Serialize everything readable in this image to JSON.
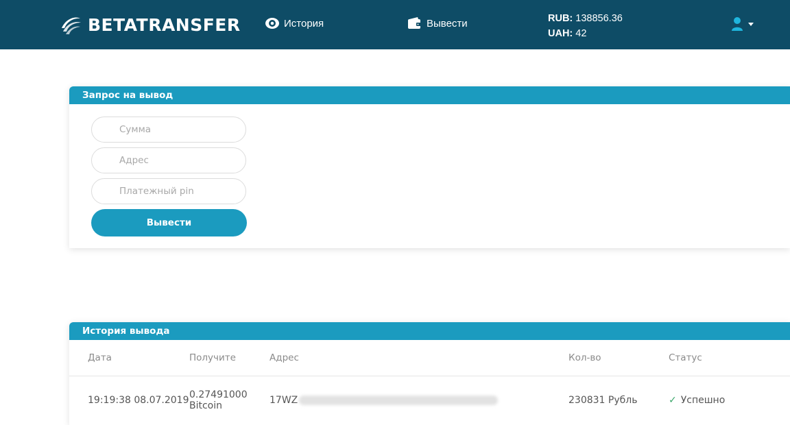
{
  "header": {
    "brand": "BETATRANSFER",
    "nav": [
      {
        "label": "История",
        "icon": "eye-icon"
      },
      {
        "label": "Вывести",
        "icon": "wallet-icon"
      }
    ],
    "balances": [
      {
        "currency": "RUB:",
        "amount": "138856.36"
      },
      {
        "currency": "UAH:",
        "amount": "42"
      }
    ],
    "user_icon": "user-icon"
  },
  "withdraw_form": {
    "title": "Запрос на вывод",
    "amount_placeholder": "Сумма",
    "address_placeholder": "Адрес",
    "pin_placeholder": "Платежный pin",
    "submit_label": "Вывести"
  },
  "history": {
    "title": "История вывода",
    "columns": [
      "Дата",
      "Получите",
      "Адрес",
      "Кол-во",
      "Статус"
    ],
    "rows": [
      {
        "date": "19:19:38 08.07.2019",
        "receive_amount": "0.27491000",
        "receive_currency": "Bitcoin",
        "address": "17WZ",
        "quantity": "230831 Рубль",
        "status": "Успешно"
      }
    ]
  },
  "colors": {
    "header_bg": "#0e4c66",
    "accent": "#1b9bbf",
    "success": "#3aa66a"
  }
}
